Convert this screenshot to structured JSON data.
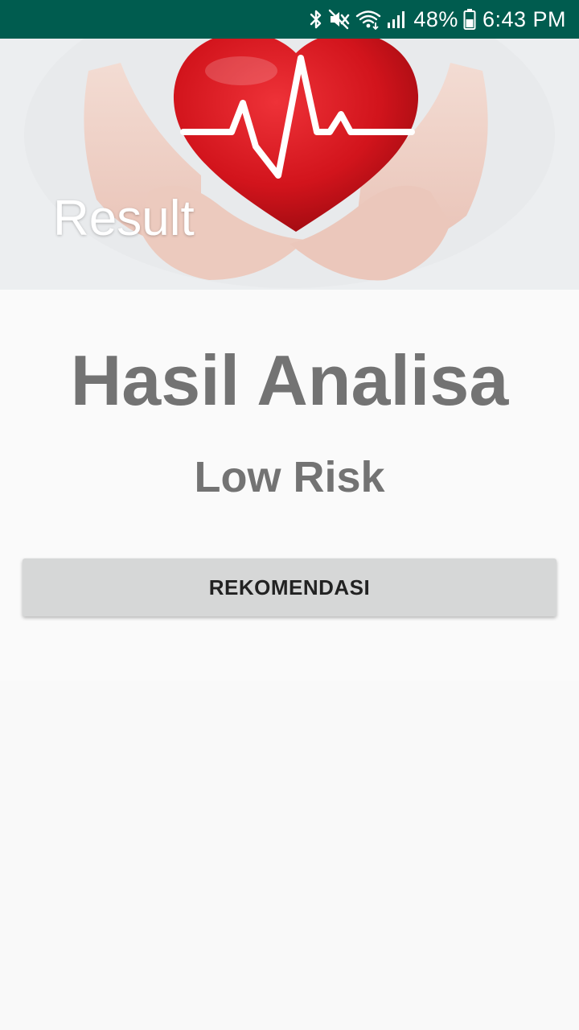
{
  "status_bar": {
    "battery_percent": "48%",
    "time": "6:43 PM",
    "icons": [
      "bluetooth-icon",
      "mute-icon",
      "wifi-icon",
      "signal-icon",
      "battery-icon"
    ]
  },
  "header": {
    "title": "Result"
  },
  "main": {
    "heading": "Hasil Analisa",
    "result": "Low Risk",
    "button_label": "REKOMENDASI"
  },
  "colors": {
    "status_bar": "#005c4f",
    "text_gray": "#737373",
    "button_bg": "#d6d7d7",
    "heart_red": "#d2141c"
  }
}
